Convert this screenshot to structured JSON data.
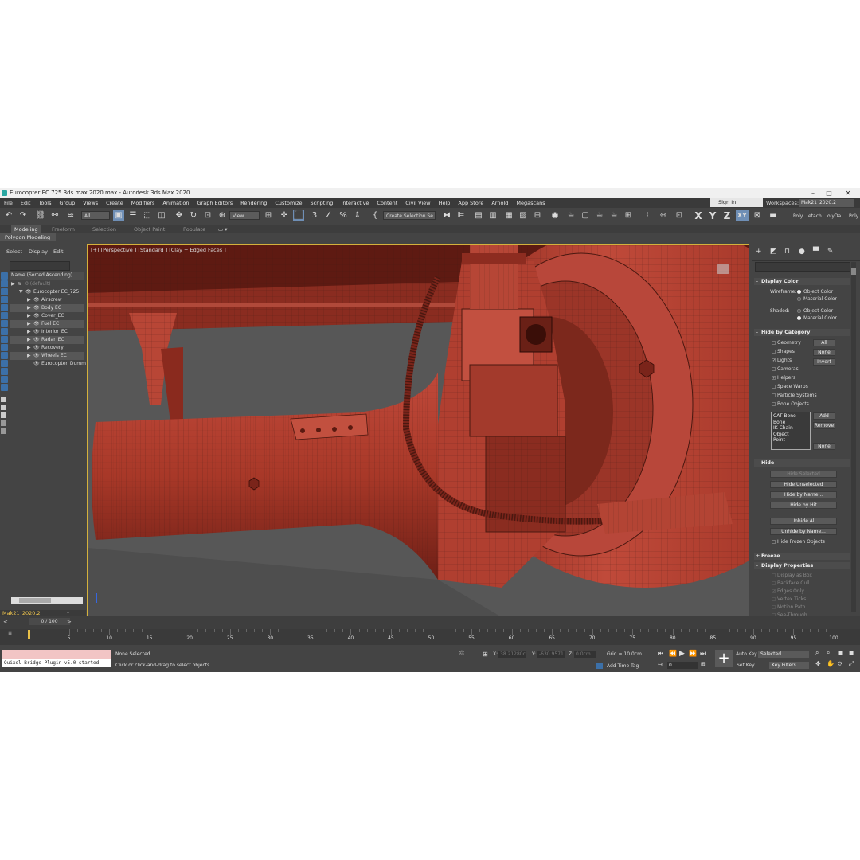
{
  "window": {
    "title": "Eurocopter EC 725 3ds max 2020.max - Autodesk 3ds Max 2020",
    "minimize": "–",
    "restore": "□",
    "close": "✕"
  },
  "menu": [
    "File",
    "Edit",
    "Tools",
    "Group",
    "Views",
    "Create",
    "Modifiers",
    "Animation",
    "Graph Editors",
    "Rendering",
    "Customize",
    "Scripting",
    "Interactive",
    "Content",
    "Civil View",
    "Help",
    "App Store",
    "Arnold",
    "Megascans"
  ],
  "account": {
    "sign_in": "Sign In",
    "workspaces_label": "Workspaces:",
    "workspace": "Mak21_2020.2"
  },
  "toolbar": {
    "filter": "All",
    "ref_coord": "View",
    "selection_set": "Create Selection Se",
    "constraint_x": "X",
    "constraint_y": "Y",
    "constraint_z": "Z",
    "constraint_xy": "XY",
    "poly_tab1": "Poly",
    "poly_tab2": "etach",
    "poly_tab3": "olyDa",
    "poly_tab4": "Poly"
  },
  "ribbon": {
    "tabs": [
      "Modeling",
      "Freeform",
      "Selection",
      "Object Paint",
      "Populate"
    ],
    "subtab": "Polygon Modeling"
  },
  "scene_explorer": {
    "menu": [
      "Select",
      "Display",
      "Edit"
    ],
    "header": "Name (Sorted Ascending)",
    "rows": [
      {
        "label": "0 (default)",
        "level": 0,
        "dim": true
      },
      {
        "label": "Eurocopter EC_725",
        "level": 1,
        "dim": false
      },
      {
        "label": "Airscrew",
        "level": 2,
        "dim": false
      },
      {
        "label": "Body EC",
        "level": 2,
        "dim": false
      },
      {
        "label": "Cover_EC",
        "level": 2,
        "dim": false
      },
      {
        "label": "Fuel EC",
        "level": 2,
        "dim": false
      },
      {
        "label": "Interior_EC",
        "level": 2,
        "dim": false
      },
      {
        "label": "Radar_EC",
        "level": 2,
        "dim": false
      },
      {
        "label": "Recovery Hook_EC",
        "level": 2,
        "dim": false
      },
      {
        "label": "Wheels EC",
        "level": 2,
        "dim": false
      },
      {
        "label": "Eurocopter_Dumm",
        "level": 2,
        "dim": false
      }
    ],
    "layer": "Mak21_2020.2"
  },
  "viewport": {
    "label": "[+] [Perspective ] [Standard ] [Clay + Edged Faces ]"
  },
  "command_panel": {
    "display_color": {
      "title": "Display Color",
      "wireframe_label": "Wireframe:",
      "shaded_label": "Shaded:",
      "object_color": "Object Color",
      "material_color": "Material Color"
    },
    "hide_by_category": {
      "title": "Hide by Category",
      "items": [
        "Geometry",
        "Shapes",
        "Lights",
        "Cameras",
        "Helpers",
        "Space Warps",
        "Particle Systems",
        "Bone Objects"
      ],
      "checked": [
        false,
        false,
        true,
        false,
        true,
        false,
        false,
        false
      ],
      "btn_all": "All",
      "btn_none": "None",
      "btn_invert": "Invert",
      "list": [
        "CAT Bone",
        "Bone",
        "IK Chain Object",
        "Point"
      ],
      "btn_add": "Add",
      "btn_remove": "Remove",
      "btn_none2": "None"
    },
    "hide": {
      "title": "Hide",
      "buttons": [
        "Hide Selected",
        "Hide Unselected",
        "Hide by Name...",
        "Hide by Hit",
        "Unhide All",
        "Unhide by Name..."
      ],
      "frozen": "Hide Frozen Objects"
    },
    "freeze": {
      "title": "Freeze"
    },
    "display_properties": {
      "title": "Display Properties",
      "items": [
        "Display as Box",
        "Backface Cull",
        "Edges Only",
        "Vertex Ticks",
        "Motion Path",
        "See-Through"
      ]
    }
  },
  "timeline": {
    "frame_display": "0 / 100",
    "ticks": [
      "0",
      "5",
      "10",
      "15",
      "20",
      "25",
      "30",
      "35",
      "40",
      "45",
      "50",
      "55",
      "60",
      "65",
      "70",
      "75",
      "80",
      "85",
      "90",
      "95",
      "100"
    ]
  },
  "status": {
    "listener": "Quixel Bridge Plugin v5.0 started",
    "selection": "None Selected",
    "prompt": "Click or click-and-drag to select objects",
    "x_label": "X:",
    "x_value": "38.21280c",
    "y_label": "Y:",
    "y_value": "-630.9571",
    "z_label": "Z:",
    "z_value": "0.0cm",
    "grid": "Grid = 10.0cm",
    "add_time_tag": "Add Time Tag",
    "auto_key": "Auto Key",
    "set_key": "Set Key",
    "key_mode": "Selected",
    "key_filters": "Key Filters...",
    "frame": "0"
  }
}
